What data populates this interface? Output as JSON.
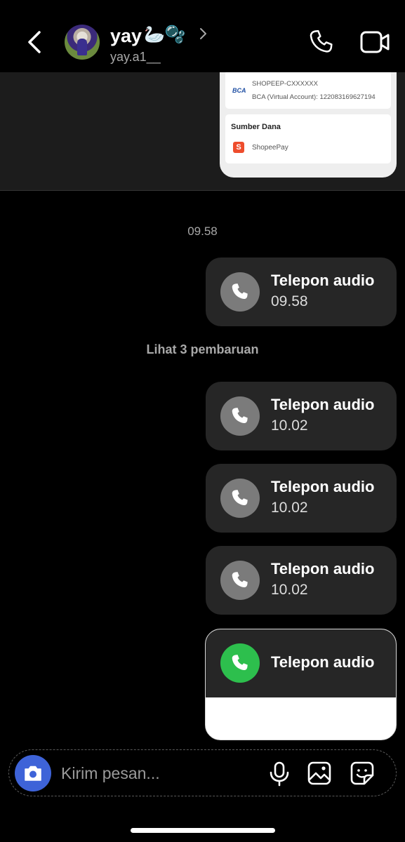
{
  "header": {
    "back_icon": "chevron-left-icon",
    "name": "yay",
    "name_emoji": "🦢🫧",
    "handle": "yay.a1__",
    "call_icon": "phone-icon",
    "video_icon": "video-camera-icon"
  },
  "receipt": {
    "bank_logo": "BCA",
    "va_code": "SHOPEEP-CXXXXXX",
    "va_line": "BCA (Virtual Account): 122083169627194",
    "source_title": "Sumber Dana",
    "source_logo": "S",
    "source_method": "ShopeePay"
  },
  "chat": {
    "time_separator": "09.58",
    "updates_label": "Lihat 3 pembaruan",
    "calls": [
      {
        "title": "Telepon audio",
        "time": "09.58"
      },
      {
        "title": "Telepon audio",
        "time": "10.02"
      },
      {
        "title": "Telepon audio",
        "time": "10.02"
      },
      {
        "title": "Telepon audio",
        "time": "10.02"
      }
    ],
    "active_call": {
      "title": "Telepon audio"
    }
  },
  "composer": {
    "placeholder": "Kirim pesan...",
    "camera_icon": "camera-icon",
    "mic_icon": "microphone-icon",
    "gallery_icon": "image-icon",
    "sticker_icon": "sticker-icon"
  },
  "colors": {
    "background": "#000000",
    "bubble": "#262626",
    "call_icon_bg": "#7b7b7b",
    "active_call_green": "#2dbf4d",
    "camera_blue": "#3e63d8"
  }
}
